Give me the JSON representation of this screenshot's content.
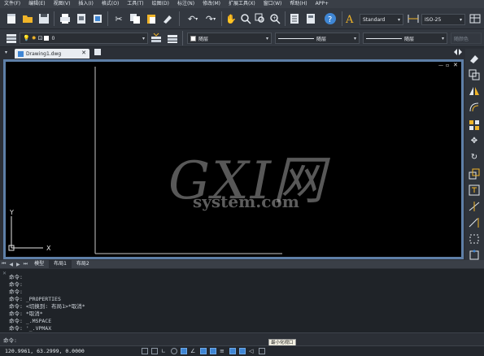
{
  "menu": [
    "文件(F)",
    "编辑(E)",
    "视图(V)",
    "插入(I)",
    "格式(O)",
    "工具(T)",
    "绘图(D)",
    "标注(N)",
    "修改(M)",
    "扩展工具(X)",
    "窗口(W)",
    "帮助(H)",
    "APP+"
  ],
  "toolbar": {
    "text_style": "Standard",
    "dim_style": "ISO-25",
    "layer_value": "0",
    "color_value": "随层",
    "linetype_value": "随层",
    "lineweight_value": "随层",
    "plotstyle_value": "随颜色"
  },
  "document_tab": {
    "label": "Drawing1.dwg"
  },
  "canvas": {
    "ucs_y": "Y",
    "ucs_x": "X",
    "watermark": "GXI网",
    "watermark_sub": "system.com"
  },
  "layout_tabs": [
    "模型",
    "布局1",
    "布局2"
  ],
  "active_layout_tab": 1,
  "command_history": [
    "命令:",
    "命令:",
    "命令:",
    "命令: _PROPERTIES",
    "命令: <切换到: 布局1>*取消*",
    "命令: *取消*",
    "命令: _.MSPACE",
    "命令: '_.VPMAX"
  ],
  "command_prompt": "命令:",
  "tooltip": "最小化视口",
  "status": {
    "coordinates": "120.9961, 63.2999, 0.0000"
  },
  "colors": {
    "canvas_bg": "#000000",
    "frame": "#5e7fa7",
    "accent": "#3f86d4"
  }
}
